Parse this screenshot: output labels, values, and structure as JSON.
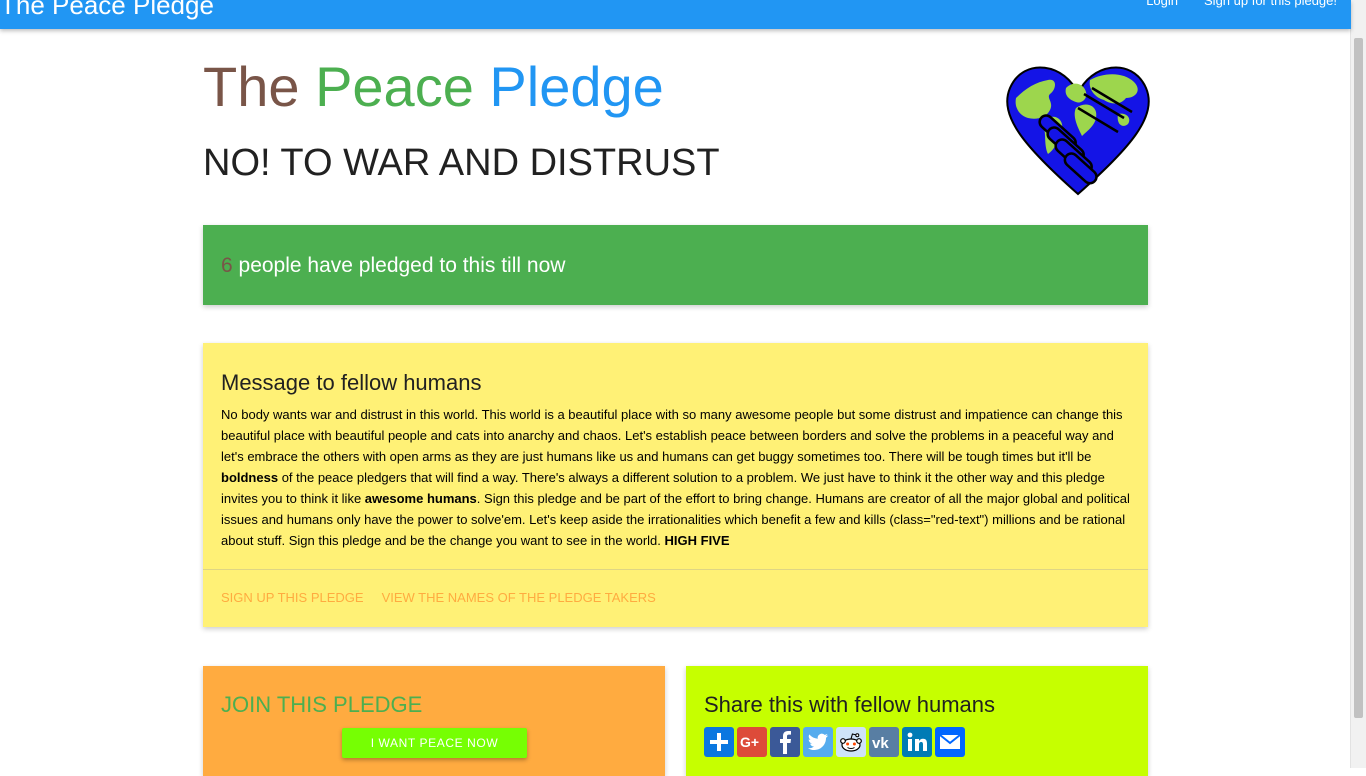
{
  "nav": {
    "brand": "The Peace Pledge",
    "login": "Login",
    "signup": "Sign up for this pledge!"
  },
  "header": {
    "title_words": [
      "The",
      "Peace",
      "Pledge"
    ],
    "subtitle": "NO! TO WAR AND DISTRUST"
  },
  "counter": {
    "count": "6",
    "suffix": " people have pledged to this till now"
  },
  "message": {
    "title": "Message to fellow humans",
    "p1": "No body wants war and distrust in this world. This world is a beautiful place with so many awesome people but some distrust and impatience can change this beautiful place with beautiful people and cats into anarchy and chaos. Let's establish peace between borders and solve the problems in a peaceful way and let's embrace the others with open arms as they are just humans like us and humans can get buggy sometimes too. There will be tough times but it'll be ",
    "b1": "boldness",
    "p2": " of the peace pledgers that will find a way. There's always a different solution to a problem. We just have to think it the other way and this pledge invites you to think it like ",
    "b2": "awesome humans",
    "p3": ". Sign this pledge and be part of the effort to bring change. Humans are creator of all the major global and political issues and humans only have the power to solve'em. Let's keep aside the irrationalities which benefit a few and kills (class=\"red-text\") millions and be rational about stuff. Sign this pledge and be the change you want to see in the world. ",
    "b3": "HIGH FIVE",
    "actions": [
      "SIGN UP THIS PLEDGE",
      "VIEW THE NAMES OF THE PLEDGE TAKERS"
    ]
  },
  "join": {
    "title": "JOIN THIS PLEDGE",
    "button": "I WANT PEACE NOW"
  },
  "share": {
    "title": "Share this with fellow humans",
    "buttons": [
      {
        "icon": "addthis-icon",
        "color": "#0a77e0"
      },
      {
        "icon": "google-plus-icon",
        "color": "#dd4b39"
      },
      {
        "icon": "facebook-icon",
        "color": "#3b5998"
      },
      {
        "icon": "twitter-icon",
        "color": "#55acee"
      },
      {
        "icon": "reddit-icon",
        "color": "#cee3f8"
      },
      {
        "icon": "vk-icon",
        "color": "#587ea3"
      },
      {
        "icon": "linkedin-icon",
        "color": "#007bb5"
      },
      {
        "icon": "email-icon",
        "color": "#0166ff"
      }
    ]
  },
  "colors": {
    "nav_blue": "#2196f3",
    "brown": "#795548",
    "green": "#4caf50",
    "message_yellow": "#fff176",
    "orange": "#ffab40",
    "lime": "#c6ff00",
    "button_green": "#76ff03"
  }
}
